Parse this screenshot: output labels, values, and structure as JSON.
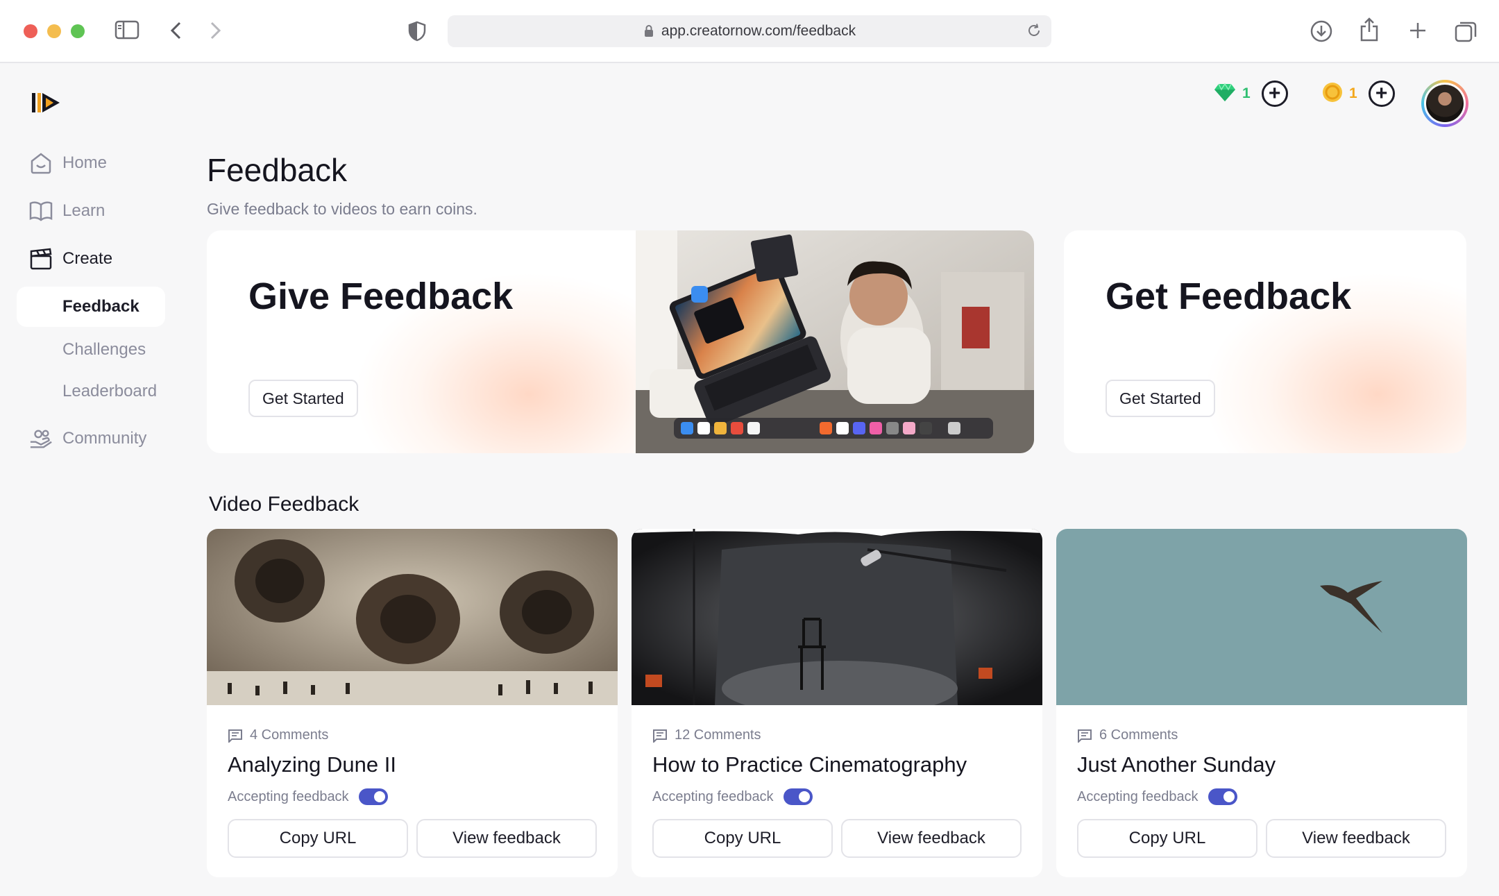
{
  "browser": {
    "url": "app.creatornow.com/feedback"
  },
  "colors": {
    "accent": "#4a56c8",
    "gem": "#2fbf71",
    "coin": "#f3a71b"
  },
  "top_bar": {
    "gems": "1",
    "coins": "1",
    "plus": "+"
  },
  "sidebar": {
    "home": "Home",
    "learn": "Learn",
    "create": "Create",
    "feedback": "Feedback",
    "challenges": "Challenges",
    "leaderboard": "Leaderboard",
    "community": "Community"
  },
  "page": {
    "title": "Feedback",
    "subtitle": "Give feedback to videos to earn coins."
  },
  "hero": {
    "give_title": "Give Feedback",
    "give_button": "Get Started",
    "get_title": "Get Feedback",
    "get_button": "Get Started"
  },
  "video_feedback": {
    "section_title": "Video Feedback",
    "cards": [
      {
        "comments": "4 Comments",
        "title": "Analyzing Dune II",
        "accepting": "Accepting feedback",
        "copy": "Copy URL",
        "view": "View feedback"
      },
      {
        "comments": "12 Comments",
        "title": "How to Practice Cinematography",
        "accepting": "Accepting feedback",
        "copy": "Copy URL",
        "view": "View feedback"
      },
      {
        "comments": "6 Comments",
        "title": "Just Another Sunday",
        "accepting": "Accepting feedback",
        "copy": "Copy URL",
        "view": "View feedback"
      }
    ]
  }
}
